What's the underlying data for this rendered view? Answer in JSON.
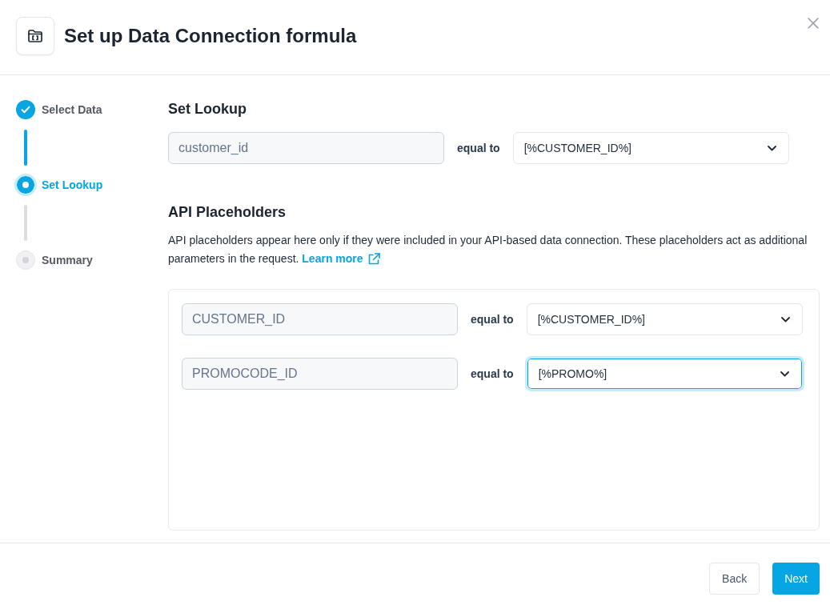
{
  "dialog": {
    "title": "Set up Data Connection formula"
  },
  "steps": [
    {
      "label": "Select Data",
      "done": true,
      "selected": false
    },
    {
      "label": "Set Lookup",
      "done": false,
      "selected": true
    },
    {
      "label": "Summary",
      "done": false,
      "selected": false
    }
  ],
  "lookup": {
    "heading": "Set Lookup",
    "field": "customer_id",
    "connector": "equal to",
    "value": "[%CUSTOMER_ID%]",
    "focused": false
  },
  "placeholders": {
    "heading": "API Placeholders",
    "description": "API placeholders appear here only if they were included in your API-based data connection. These placeholders act as additional parameters in the request.",
    "link": "Learn more",
    "rows": [
      {
        "field": "CUSTOMER_ID",
        "connector": "equal to",
        "value": "[%CUSTOMER_ID%]",
        "focused": false
      },
      {
        "field": "PROMOCODE_ID",
        "connector": "equal to",
        "value": "[%PROMO%]",
        "focused": true
      }
    ]
  },
  "buttons": [
    {
      "label": "Back",
      "kind": "secondary"
    },
    {
      "label": "Next",
      "kind": "primary"
    }
  ]
}
